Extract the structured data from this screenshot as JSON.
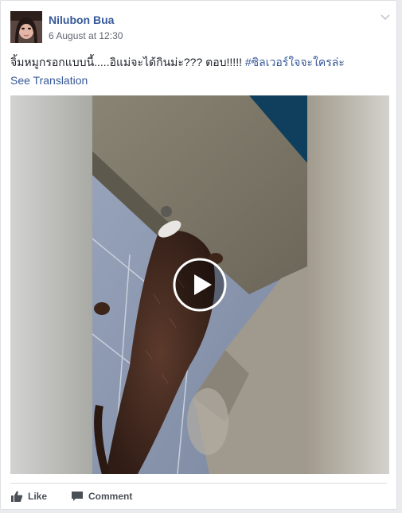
{
  "post": {
    "author": "Nilubon Bua",
    "timestamp": "6 August at 12:30",
    "text": "จิ้มหมูกรอกแบบนี้.....อิแม่จะได้กินม่ะ??? ตอบ!!!!! ",
    "hashtag": "#ซิลเวอร์ใจจะใครล่ะ",
    "translation_link": "See Translation"
  },
  "actions": {
    "like": "Like",
    "comment": "Comment"
  },
  "icons": {
    "options": "chevron-down-icon",
    "play": "play-icon",
    "like": "thumbs-up-icon",
    "comment": "speech-bubble-icon"
  },
  "colors": {
    "link": "#365899",
    "text": "#1d2129",
    "meta": "#616770",
    "action": "#4b4f56"
  }
}
